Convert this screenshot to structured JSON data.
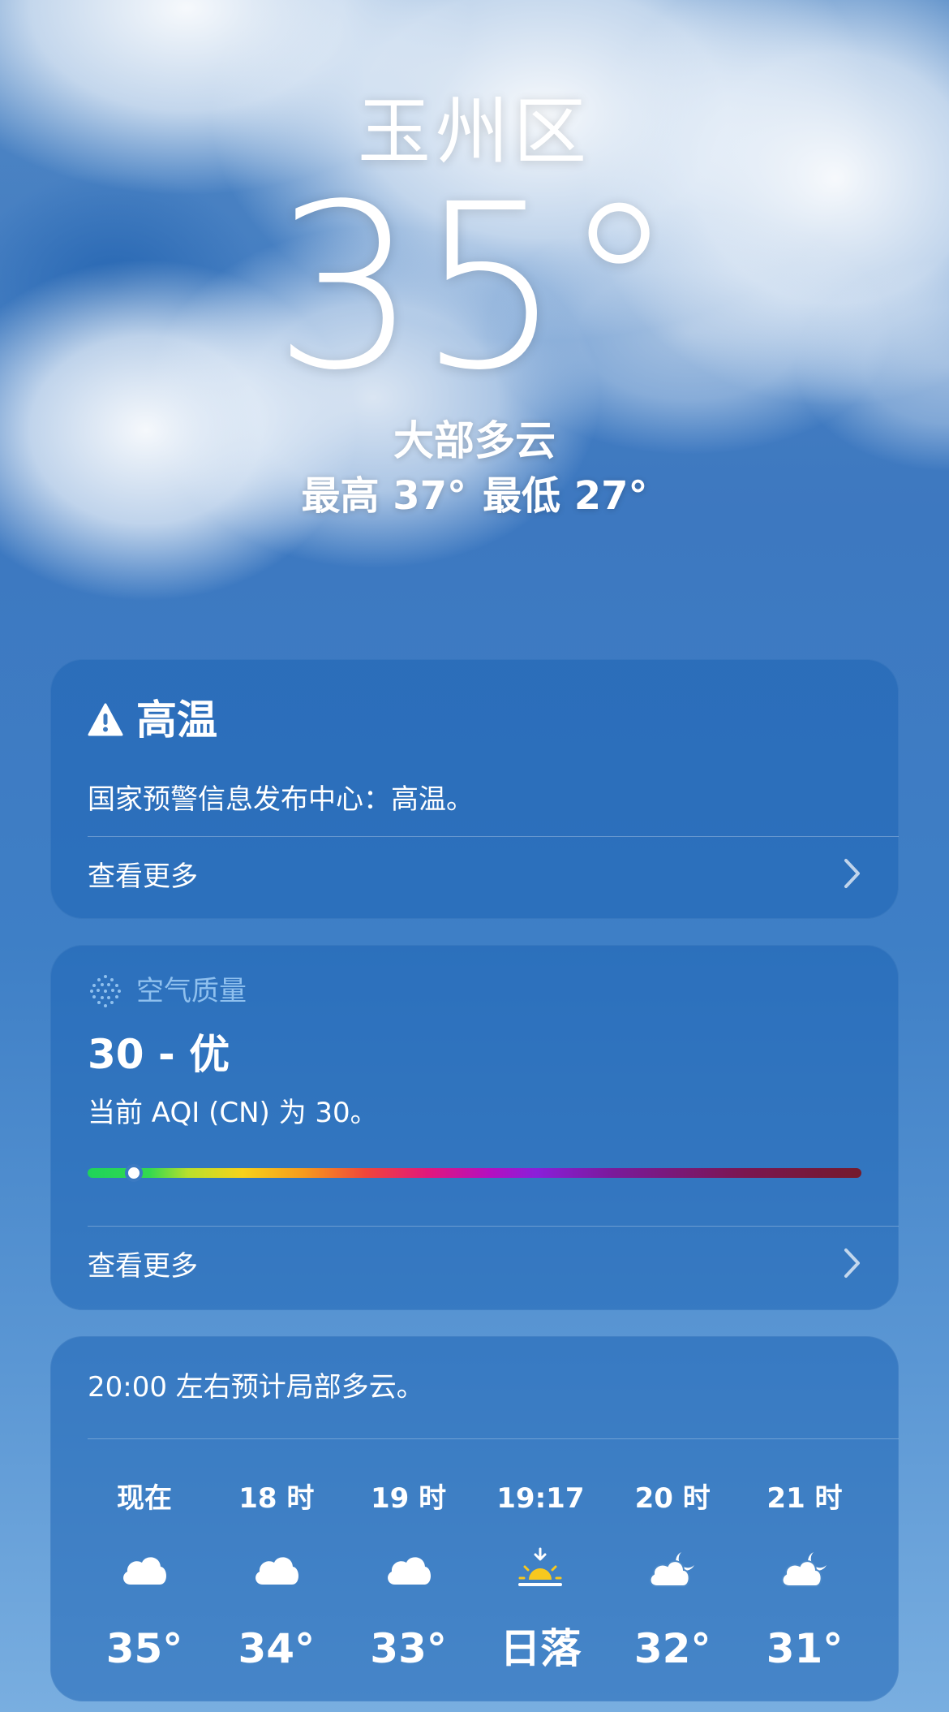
{
  "location": {
    "city": "玉州区",
    "temperature": "35°",
    "condition": "大部多云",
    "high": "最高 37°",
    "low": "最低 27°"
  },
  "alert_card": {
    "title": "高温",
    "icon": "warning-icon",
    "text": "国家预警信息发布中心：高温。",
    "more_label": "查看更多"
  },
  "aqi_card": {
    "title": "空气质量",
    "icon": "air-quality-icon",
    "value": "30 - 优",
    "description": "当前 AQI (CN) 为 30。",
    "level_fraction": 0.06,
    "more_label": "查看更多"
  },
  "hourly_card": {
    "summary": "20:00 左右预计局部多云。",
    "hours": [
      {
        "label": "现在",
        "icon": "cloud-icon",
        "temp": "35°"
      },
      {
        "label": "18 时",
        "icon": "cloud-icon",
        "temp": "34°"
      },
      {
        "label": "19 时",
        "icon": "cloud-icon",
        "temp": "33°"
      },
      {
        "label": "19:17",
        "icon": "sunset-icon",
        "temp": "日落"
      },
      {
        "label": "20 时",
        "icon": "cloud-moon-icon",
        "temp": "32°"
      },
      {
        "label": "21 时",
        "icon": "cloud-moon-icon",
        "temp": "31°"
      }
    ]
  },
  "colors": {
    "sunset_accent": "#f7c81e",
    "aqi_title": "#8fc0ee"
  }
}
